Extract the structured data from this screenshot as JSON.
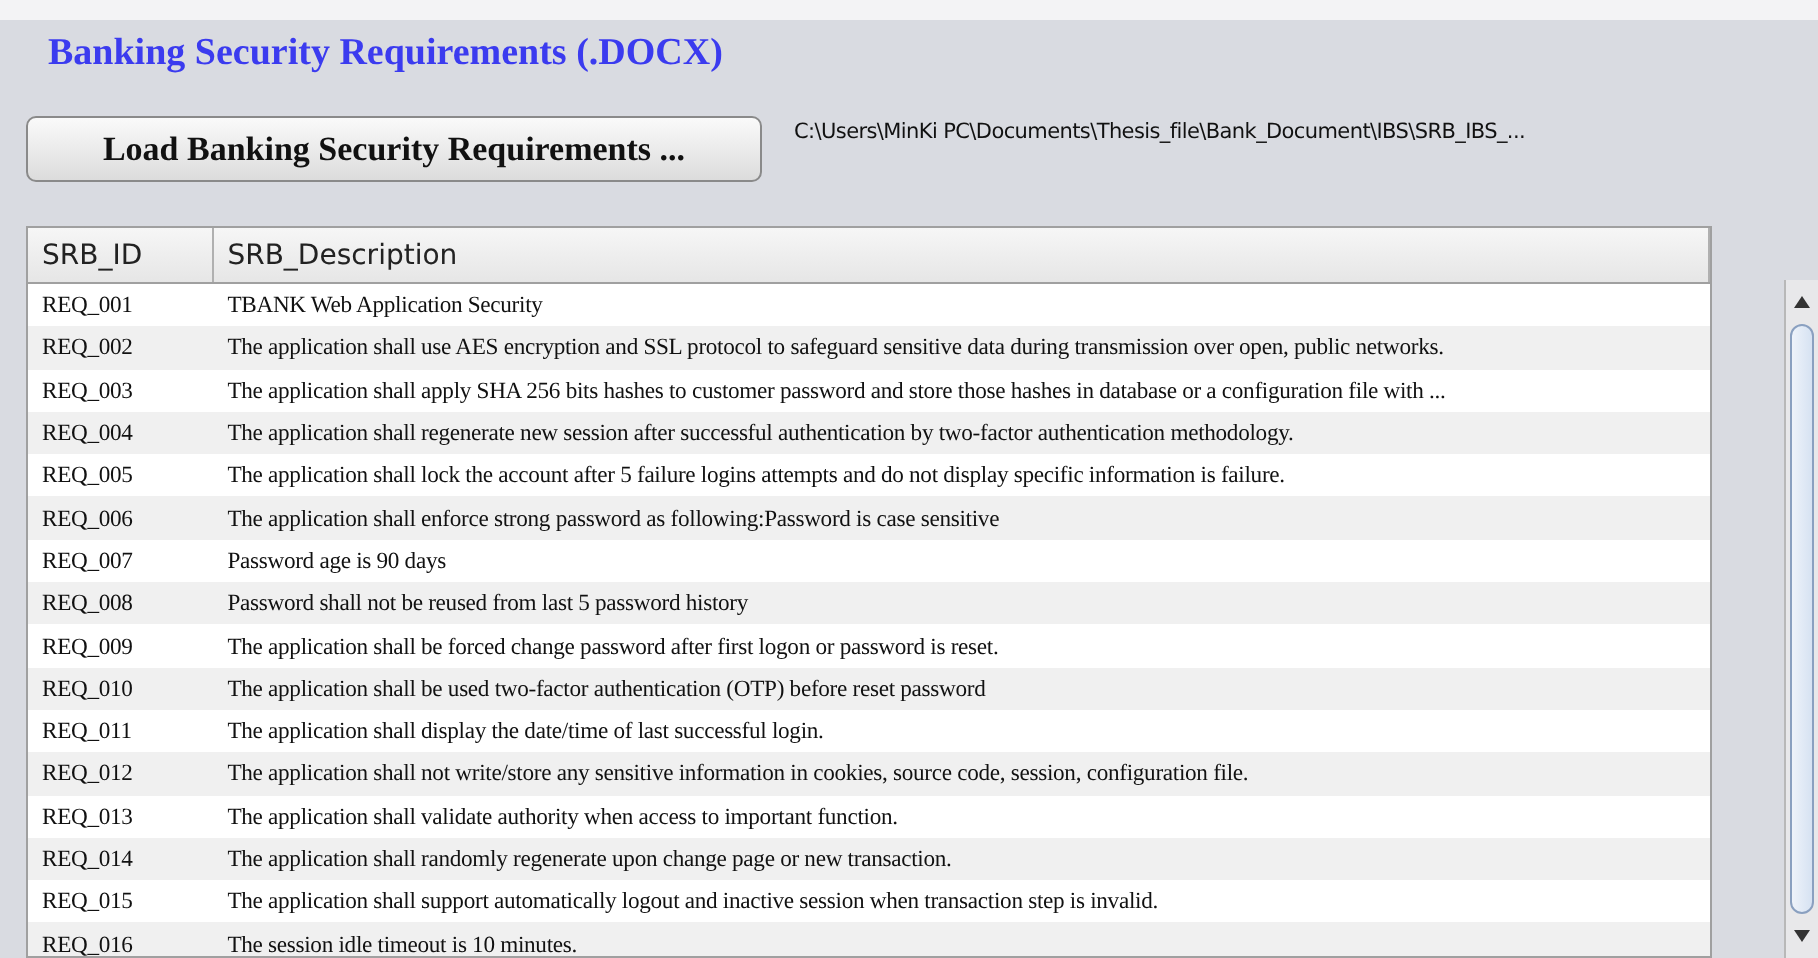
{
  "title": "Banking Security Requirements (.DOCX)",
  "load_button": "Load Banking Security Requirements ...",
  "file_path": "C:\\Users\\MinKi PC\\Documents\\Thesis_file\\Bank_Document\\IBS\\SRB_IBS_...",
  "table": {
    "columns": [
      "SRB_ID",
      "SRB_Description"
    ],
    "rows": [
      {
        "id": "REQ_001",
        "description": "TBANK Web Application Security"
      },
      {
        "id": "REQ_002",
        "description": "The application shall use AES encryption and SSL protocol to safeguard sensitive data during transmission over open, public networks."
      },
      {
        "id": "REQ_003",
        "description": "The application shall apply SHA 256 bits hashes to customer password and store those hashes in database or a configuration file with ..."
      },
      {
        "id": "REQ_004",
        "description": "The application shall regenerate new session after successful authentication by two-factor authentication methodology."
      },
      {
        "id": "REQ_005",
        "description": "The application shall lock the account after 5 failure logins attempts and do not display specific information is failure."
      },
      {
        "id": "REQ_006",
        "description": "The application shall enforce strong password as following:Password is case sensitive"
      },
      {
        "id": "REQ_007",
        "description": "Password age is 90 days"
      },
      {
        "id": "REQ_008",
        "description": "Password shall not be reused from last 5 password history"
      },
      {
        "id": "REQ_009",
        "description": "The application shall be forced change password after first logon or password is reset."
      },
      {
        "id": "REQ_010",
        "description": "The application shall be used two-factor authentication (OTP) before reset password"
      },
      {
        "id": "REQ_011",
        "description": "The application shall display the date/time of last successful login."
      },
      {
        "id": "REQ_012",
        "description": "The application shall not write/store any sensitive information in cookies, source code, session, configuration file."
      },
      {
        "id": "REQ_013",
        "description": "The application shall validate authority when access to important function."
      },
      {
        "id": "REQ_014",
        "description": "The application shall randomly regenerate upon change page or new transaction."
      },
      {
        "id": "REQ_015",
        "description": "The application shall support automatically logout and inactive session when transaction step is invalid."
      },
      {
        "id": "REQ_016",
        "description": "The session idle timeout is 10 minutes."
      }
    ]
  }
}
